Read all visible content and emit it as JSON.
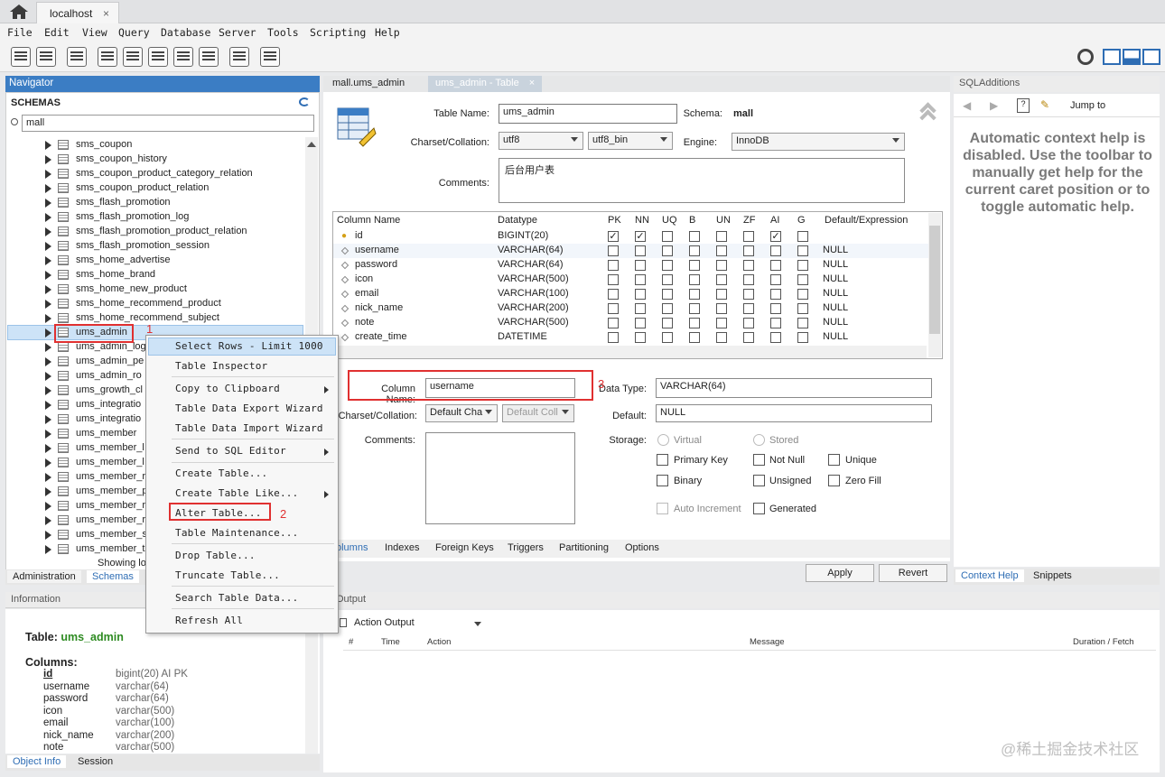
{
  "window": {
    "tab_title": "localhost",
    "tab_close": "×"
  },
  "menu": [
    "File",
    "Edit",
    "View",
    "Query",
    "Database",
    "Server",
    "Tools",
    "Scripting",
    "Help"
  ],
  "navigator": {
    "title": "Navigator",
    "schemas_label": "SCHEMAS",
    "search_value": "mall",
    "tables": [
      "sms_coupon",
      "sms_coupon_history",
      "sms_coupon_product_category_relation",
      "sms_coupon_product_relation",
      "sms_flash_promotion",
      "sms_flash_promotion_log",
      "sms_flash_promotion_product_relation",
      "sms_flash_promotion_session",
      "sms_home_advertise",
      "sms_home_brand",
      "sms_home_new_product",
      "sms_home_recommend_product",
      "sms_home_recommend_subject",
      "ums_admin",
      "ums_admin_log",
      "ums_admin_pe",
      "ums_admin_ro",
      "ums_growth_cl",
      "ums_integratio",
      "ums_integratio",
      "ums_member",
      "ums_member_l",
      "ums_member_l",
      "ums_member_r",
      "ums_member_p",
      "ums_member_r",
      "ums_member_r",
      "ums_member_s",
      "ums_member_t"
    ],
    "showing": "Showing lo",
    "tabs": [
      "Administration",
      "Schemas"
    ]
  },
  "info": {
    "title": "Information",
    "table_label": "Table:",
    "table_name": "ums_admin",
    "columns_label": "Columns:",
    "columns": [
      {
        "name": "id",
        "type": "bigint(20) AI PK"
      },
      {
        "name": "username",
        "type": "varchar(64)"
      },
      {
        "name": "password",
        "type": "varchar(64)"
      },
      {
        "name": "icon",
        "type": "varchar(500)"
      },
      {
        "name": "email",
        "type": "varchar(100)"
      },
      {
        "name": "nick_name",
        "type": "varchar(200)"
      },
      {
        "name": "note",
        "type": "varchar(500)"
      }
    ],
    "tabs": [
      "Object Info",
      "Session"
    ]
  },
  "context_menu": {
    "items": [
      "Select Rows - Limit 1000",
      "Table Inspector",
      "Copy to Clipboard",
      "Table Data Export Wizard",
      "Table Data Import Wizard",
      "Send to SQL Editor",
      "Create Table...",
      "Create Table Like...",
      "Alter Table...",
      "Table Maintenance...",
      "Drop Table...",
      "Truncate Table...",
      "Search Table Data...",
      "Refresh All"
    ]
  },
  "annotations": {
    "n1": "1",
    "n2": "2",
    "n3": "3"
  },
  "editor": {
    "tabs": [
      "mall.ums_admin",
      "ums_admin - Table"
    ],
    "table_name_label": "Table Name:",
    "table_name": "ums_admin",
    "schema_label": "Schema:",
    "schema": "mall",
    "charset_label": "Charset/Collation:",
    "charset": "utf8",
    "collation": "utf8_bin",
    "engine_label": "Engine:",
    "engine": "InnoDB",
    "comments_label": "Comments:",
    "comments": "后台用户表",
    "grid_headers": [
      "Column Name",
      "Datatype",
      "PK",
      "NN",
      "UQ",
      "B",
      "UN",
      "ZF",
      "AI",
      "G",
      "Default/Expression"
    ],
    "rows": [
      {
        "name": "id",
        "type": "BIGINT(20)",
        "default": ""
      },
      {
        "name": "username",
        "type": "VARCHAR(64)",
        "default": "NULL"
      },
      {
        "name": "password",
        "type": "VARCHAR(64)",
        "default": "NULL"
      },
      {
        "name": "icon",
        "type": "VARCHAR(500)",
        "default": "NULL"
      },
      {
        "name": "email",
        "type": "VARCHAR(100)",
        "default": "NULL"
      },
      {
        "name": "nick_name",
        "type": "VARCHAR(200)",
        "default": "NULL"
      },
      {
        "name": "note",
        "type": "VARCHAR(500)",
        "default": "NULL"
      },
      {
        "name": "create_time",
        "type": "DATETIME",
        "default": "NULL"
      }
    ],
    "detail": {
      "column_name_label": "Column Name:",
      "column_name": "username",
      "data_type_label": "Data Type:",
      "data_type": "VARCHAR(64)",
      "charset_label": "Charset/Collation:",
      "charset": "Default Cha",
      "collation": "Default Coll",
      "default_label": "Default:",
      "default": "NULL",
      "comments_label": "Comments:",
      "storage_label": "Storage:",
      "virtual": "Virtual",
      "stored": "Stored",
      "primary_key": "Primary Key",
      "not_null": "Not Null",
      "unique": "Unique",
      "binary": "Binary",
      "unsigned": "Unsigned",
      "zero_fill": "Zero Fill",
      "auto_increment": "Auto Increment",
      "generated": "Generated"
    },
    "sub_tabs": [
      "olumns",
      "Indexes",
      "Foreign Keys",
      "Triggers",
      "Partitioning",
      "Options"
    ],
    "apply": "Apply",
    "revert": "Revert"
  },
  "output": {
    "title": "Output",
    "mode": "Action Output",
    "headers": [
      "#",
      "Time",
      "Action",
      "Message",
      "Duration / Fetch"
    ]
  },
  "sql_additions": {
    "title": "SQLAdditions",
    "jump_to": "Jump to",
    "help": "Automatic context help is disabled. Use the toolbar to manually get help for the current caret position or to toggle automatic help.",
    "tabs": [
      "Context Help",
      "Snippets"
    ]
  },
  "watermark": "@稀土掘金技术社区"
}
